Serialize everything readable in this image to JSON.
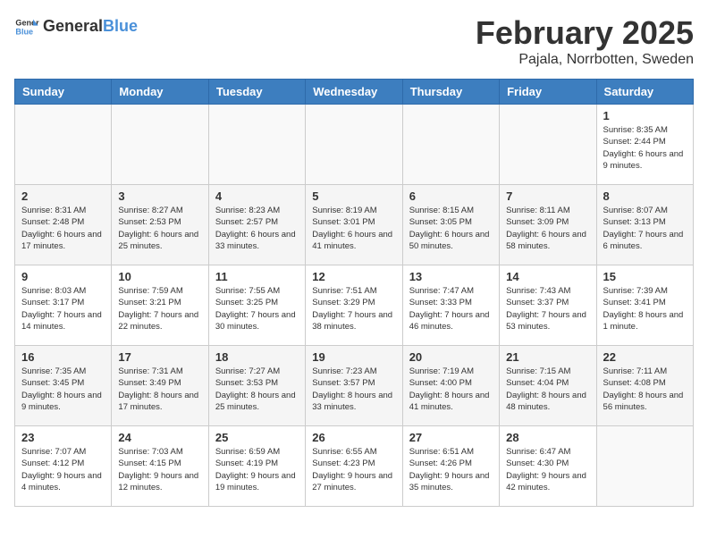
{
  "logo": {
    "text_general": "General",
    "text_blue": "Blue"
  },
  "header": {
    "month": "February 2025",
    "location": "Pajala, Norrbotten, Sweden"
  },
  "weekdays": [
    "Sunday",
    "Monday",
    "Tuesday",
    "Wednesday",
    "Thursday",
    "Friday",
    "Saturday"
  ],
  "weeks": [
    [
      {
        "day": "",
        "info": ""
      },
      {
        "day": "",
        "info": ""
      },
      {
        "day": "",
        "info": ""
      },
      {
        "day": "",
        "info": ""
      },
      {
        "day": "",
        "info": ""
      },
      {
        "day": "",
        "info": ""
      },
      {
        "day": "1",
        "info": "Sunrise: 8:35 AM\nSunset: 2:44 PM\nDaylight: 6 hours and 9 minutes."
      }
    ],
    [
      {
        "day": "2",
        "info": "Sunrise: 8:31 AM\nSunset: 2:48 PM\nDaylight: 6 hours and 17 minutes."
      },
      {
        "day": "3",
        "info": "Sunrise: 8:27 AM\nSunset: 2:53 PM\nDaylight: 6 hours and 25 minutes."
      },
      {
        "day": "4",
        "info": "Sunrise: 8:23 AM\nSunset: 2:57 PM\nDaylight: 6 hours and 33 minutes."
      },
      {
        "day": "5",
        "info": "Sunrise: 8:19 AM\nSunset: 3:01 PM\nDaylight: 6 hours and 41 minutes."
      },
      {
        "day": "6",
        "info": "Sunrise: 8:15 AM\nSunset: 3:05 PM\nDaylight: 6 hours and 50 minutes."
      },
      {
        "day": "7",
        "info": "Sunrise: 8:11 AM\nSunset: 3:09 PM\nDaylight: 6 hours and 58 minutes."
      },
      {
        "day": "8",
        "info": "Sunrise: 8:07 AM\nSunset: 3:13 PM\nDaylight: 7 hours and 6 minutes."
      }
    ],
    [
      {
        "day": "9",
        "info": "Sunrise: 8:03 AM\nSunset: 3:17 PM\nDaylight: 7 hours and 14 minutes."
      },
      {
        "day": "10",
        "info": "Sunrise: 7:59 AM\nSunset: 3:21 PM\nDaylight: 7 hours and 22 minutes."
      },
      {
        "day": "11",
        "info": "Sunrise: 7:55 AM\nSunset: 3:25 PM\nDaylight: 7 hours and 30 minutes."
      },
      {
        "day": "12",
        "info": "Sunrise: 7:51 AM\nSunset: 3:29 PM\nDaylight: 7 hours and 38 minutes."
      },
      {
        "day": "13",
        "info": "Sunrise: 7:47 AM\nSunset: 3:33 PM\nDaylight: 7 hours and 46 minutes."
      },
      {
        "day": "14",
        "info": "Sunrise: 7:43 AM\nSunset: 3:37 PM\nDaylight: 7 hours and 53 minutes."
      },
      {
        "day": "15",
        "info": "Sunrise: 7:39 AM\nSunset: 3:41 PM\nDaylight: 8 hours and 1 minute."
      }
    ],
    [
      {
        "day": "16",
        "info": "Sunrise: 7:35 AM\nSunset: 3:45 PM\nDaylight: 8 hours and 9 minutes."
      },
      {
        "day": "17",
        "info": "Sunrise: 7:31 AM\nSunset: 3:49 PM\nDaylight: 8 hours and 17 minutes."
      },
      {
        "day": "18",
        "info": "Sunrise: 7:27 AM\nSunset: 3:53 PM\nDaylight: 8 hours and 25 minutes."
      },
      {
        "day": "19",
        "info": "Sunrise: 7:23 AM\nSunset: 3:57 PM\nDaylight: 8 hours and 33 minutes."
      },
      {
        "day": "20",
        "info": "Sunrise: 7:19 AM\nSunset: 4:00 PM\nDaylight: 8 hours and 41 minutes."
      },
      {
        "day": "21",
        "info": "Sunrise: 7:15 AM\nSunset: 4:04 PM\nDaylight: 8 hours and 48 minutes."
      },
      {
        "day": "22",
        "info": "Sunrise: 7:11 AM\nSunset: 4:08 PM\nDaylight: 8 hours and 56 minutes."
      }
    ],
    [
      {
        "day": "23",
        "info": "Sunrise: 7:07 AM\nSunset: 4:12 PM\nDaylight: 9 hours and 4 minutes."
      },
      {
        "day": "24",
        "info": "Sunrise: 7:03 AM\nSunset: 4:15 PM\nDaylight: 9 hours and 12 minutes."
      },
      {
        "day": "25",
        "info": "Sunrise: 6:59 AM\nSunset: 4:19 PM\nDaylight: 9 hours and 19 minutes."
      },
      {
        "day": "26",
        "info": "Sunrise: 6:55 AM\nSunset: 4:23 PM\nDaylight: 9 hours and 27 minutes."
      },
      {
        "day": "27",
        "info": "Sunrise: 6:51 AM\nSunset: 4:26 PM\nDaylight: 9 hours and 35 minutes."
      },
      {
        "day": "28",
        "info": "Sunrise: 6:47 AM\nSunset: 4:30 PM\nDaylight: 9 hours and 42 minutes."
      },
      {
        "day": "",
        "info": ""
      }
    ]
  ]
}
